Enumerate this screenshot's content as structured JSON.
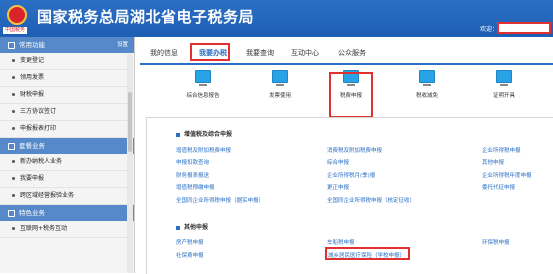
{
  "header": {
    "title": "国家税务总局湖北省电子税务局",
    "logo_caption": "中国税务",
    "welcome": "欢迎："
  },
  "sidebar": {
    "section1": {
      "label": "常用功能",
      "setting": "设置"
    },
    "items1": [
      "变更登记",
      "领用发票",
      "财税申报",
      "三方协议签订",
      "申报报表打印"
    ],
    "section2": {
      "label": "套餐业务"
    },
    "items2": [
      "新办纳税人业务",
      "我要申报",
      "跨区域经营报验业务"
    ],
    "section3": {
      "label": "特色业务"
    },
    "items3": [
      "互联网+税务互动"
    ]
  },
  "tabs": [
    "我的信息",
    "我要办税",
    "我要查询",
    "互动中心",
    "公众服务"
  ],
  "cards": [
    "综合信息报告",
    "发票使用",
    "税费申报",
    "税收减免",
    "证明开具"
  ],
  "sections": {
    "s1_title": "增值税及综合申报",
    "s1_links": [
      [
        "增值税及附加税费申报",
        "消费税及附加税费申报",
        "企业所得税申报"
      ],
      [
        "申报扣款查询",
        "综合申报",
        "其他申报"
      ],
      [
        "财务报表报送",
        "企业所得税月(季)报",
        "企业所得税年度申报"
      ],
      [
        "增值税预缴申报",
        "更正申报",
        "委托代征申报"
      ],
      [
        "全国同企业所得税申报（据实申报）",
        "全国同企业所得税申报（核定征收）",
        ""
      ]
    ],
    "s2_title": "其他申报",
    "s2_links": [
      [
        "房产税申报",
        "车船税申报",
        "环保税申报"
      ],
      [
        "社保费申报",
        "城乡居民医疗保险（学校申报）",
        ""
      ]
    ]
  }
}
